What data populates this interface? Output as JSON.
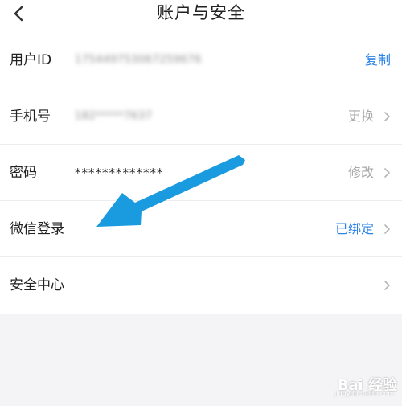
{
  "header": {
    "title": "账户与安全"
  },
  "rows": [
    {
      "label": "用户ID",
      "value": "175449753067259676",
      "action": "复制"
    },
    {
      "label": "手机号",
      "value": "182*****7637",
      "action": "更换"
    },
    {
      "label": "密码",
      "value": "*************",
      "action": "修改"
    },
    {
      "label": "微信登录",
      "value": "",
      "action": "已绑定"
    },
    {
      "label": "安全中心",
      "value": "",
      "action": ""
    }
  ],
  "watermark": {
    "text": "Bai 经验",
    "sub": "jingyan.baidu.com"
  },
  "colors": {
    "accent": "#2b83e6",
    "arrow": "#1a9be0",
    "secondary_text": "#a8a8a8",
    "page_bg": "#f4f4f6"
  }
}
